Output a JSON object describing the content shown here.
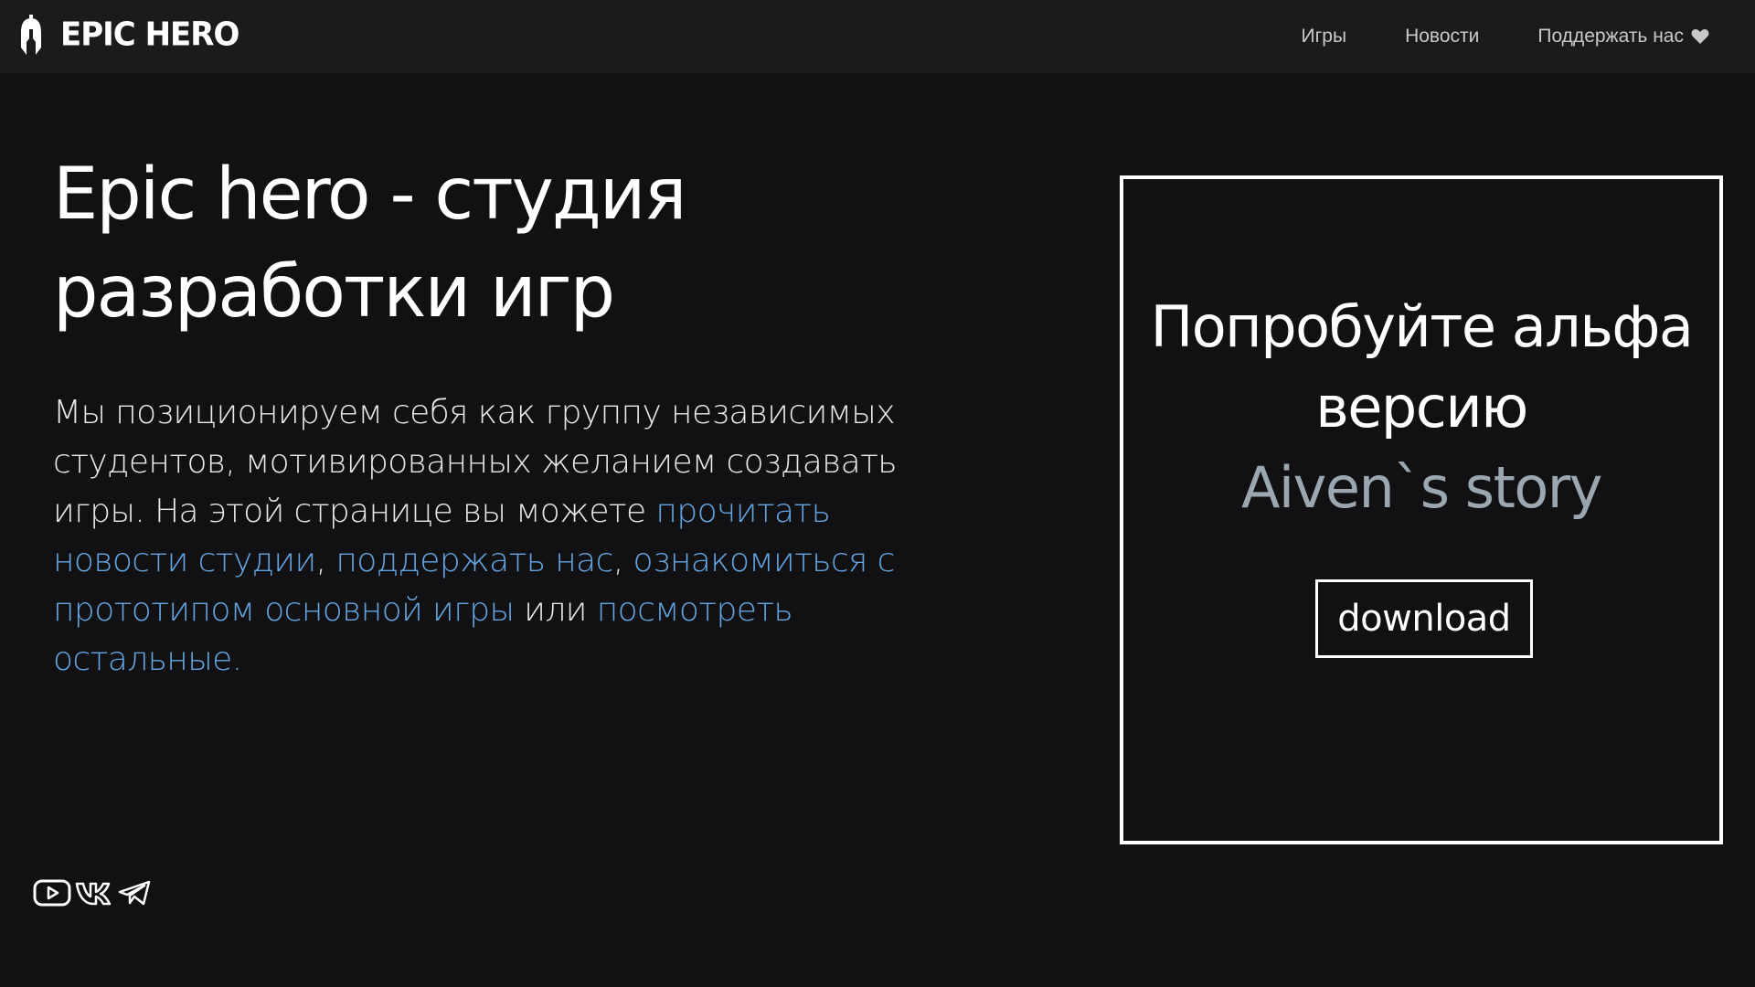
{
  "header": {
    "logo_text": "EPIC HERO",
    "nav": [
      {
        "label": "Игры"
      },
      {
        "label": "Новости"
      },
      {
        "label": "Поддержать нас",
        "icon": "heart-icon"
      }
    ]
  },
  "hero": {
    "title": "Epic hero - студия разработки игр",
    "text_intro": "Мы позиционируем себя как группу независимых студентов, мотивированных желанием создавать игры. На этой странице вы можете ",
    "link_news": "прочитать новости студии",
    "sep1": ", ",
    "link_support": "поддержать нас",
    "sep2": ", ",
    "link_prototype": "ознакомиться с прототипом основной игры",
    "sep3": " или ",
    "link_others": "посмотреть остальные."
  },
  "promo": {
    "title": "Попробуйте альфа версию",
    "game_name": "Aiven`s story",
    "button_label": "download"
  },
  "socials": [
    {
      "icon": "youtube-icon"
    },
    {
      "icon": "vk-icon"
    },
    {
      "icon": "telegram-icon"
    }
  ],
  "colors": {
    "background": "#111113",
    "header_bg": "#1b1b1d",
    "link": "#63a6e3",
    "game_name": "#9aa7b0"
  }
}
